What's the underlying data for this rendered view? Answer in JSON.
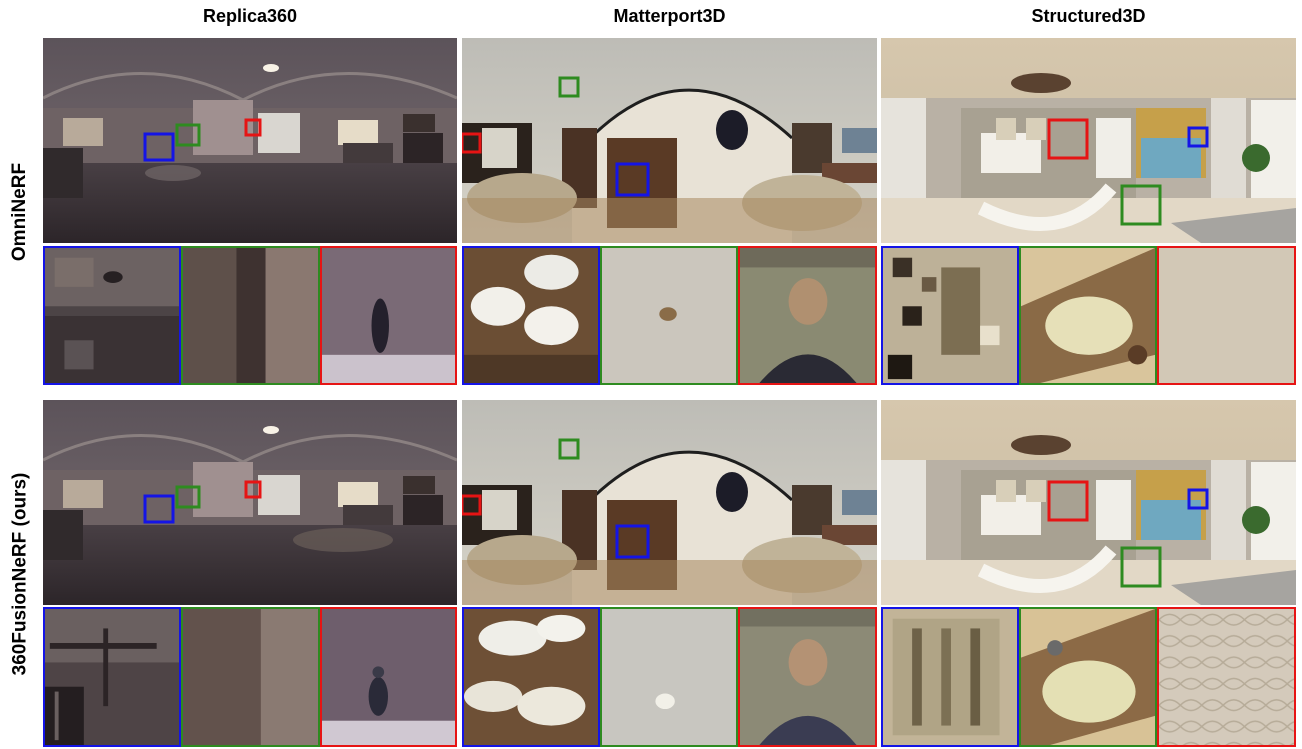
{
  "columns": [
    {
      "title": "Replica360"
    },
    {
      "title": "Matterport3D"
    },
    {
      "title": "Structured3D"
    }
  ],
  "rows": [
    {
      "label": "OmniNeRF"
    },
    {
      "label": "360FusionNeRF (ours)"
    }
  ],
  "box_colors": {
    "blue": "#1414e6",
    "green": "#2e8b20",
    "red": "#e61414"
  }
}
